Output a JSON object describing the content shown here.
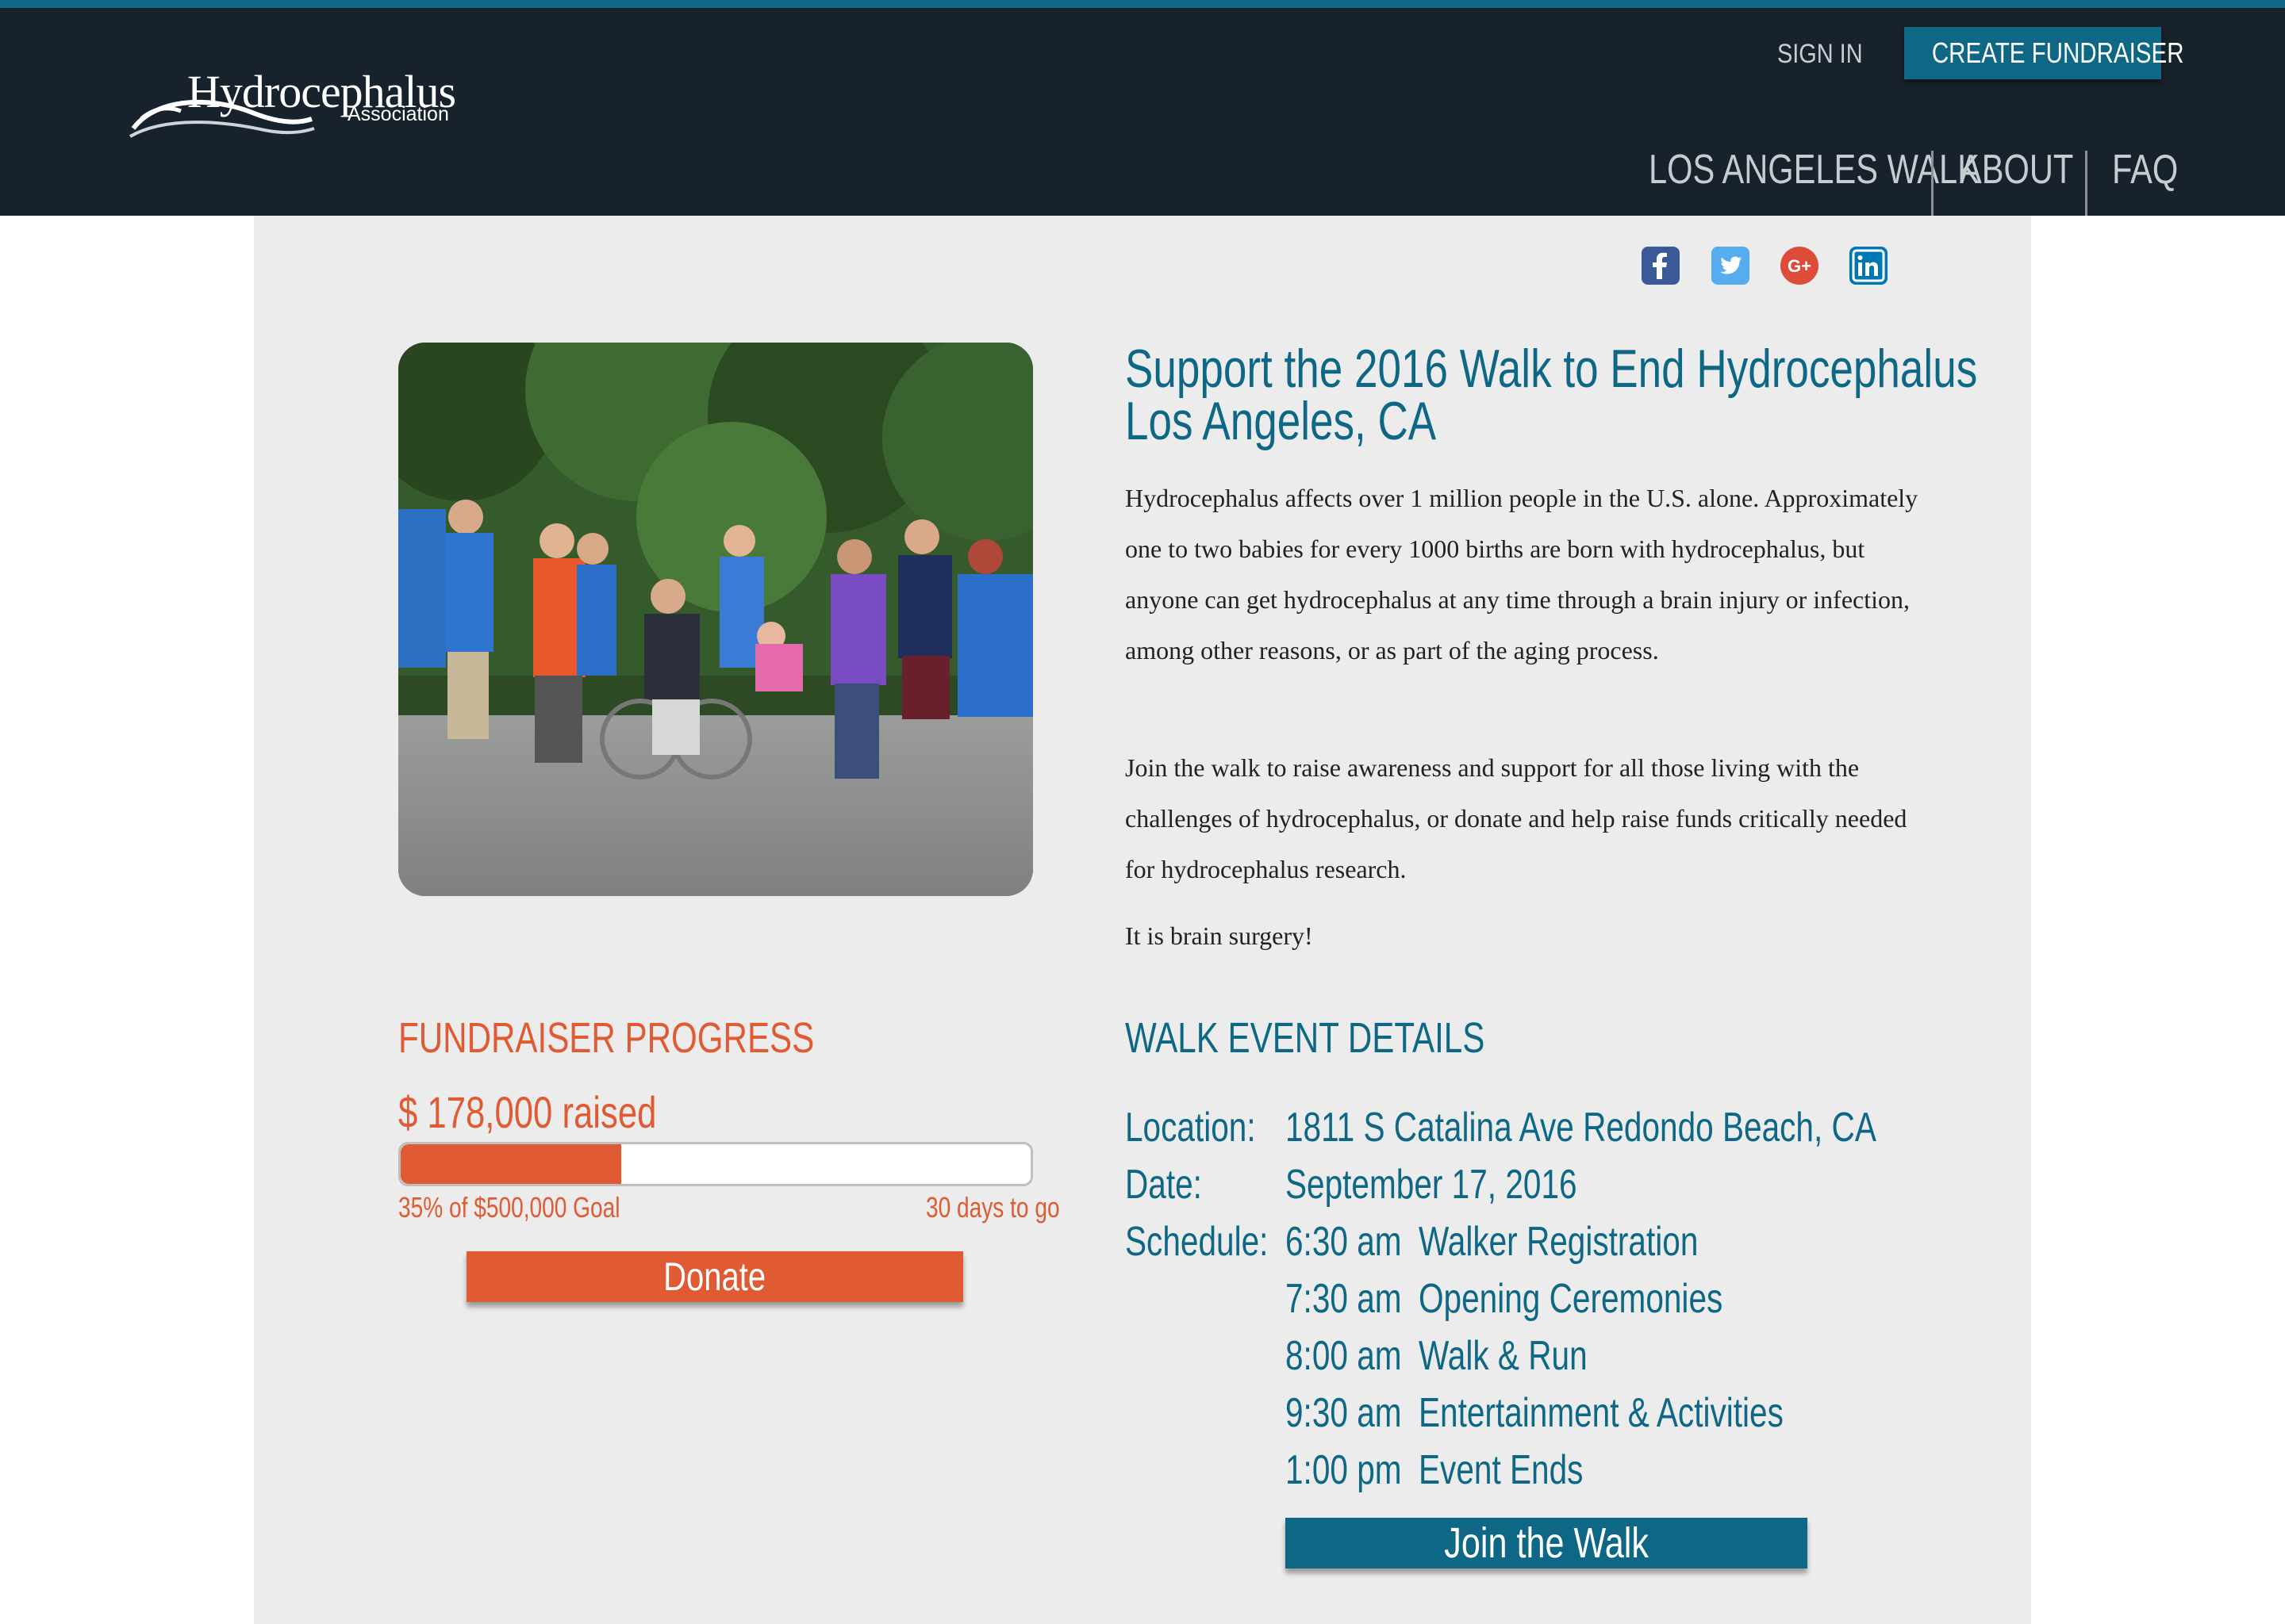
{
  "header": {
    "logo_wordmark": "Hydrocephalus",
    "logo_sub": "Association",
    "sign_in": "SIGN IN",
    "create_fundraiser": "CREATE FUNDRAISER",
    "nav": [
      "LOS ANGELES WALK",
      "ABOUT",
      "FAQ"
    ]
  },
  "social": [
    "facebook-icon",
    "twitter-icon",
    "google-plus-icon",
    "linkedin-icon"
  ],
  "colors": {
    "header_bg": "#18222c",
    "accent_blue": "#0e6785",
    "accent_orange": "#e05a33",
    "panel_bg": "#ececec"
  },
  "main": {
    "title_line1": "Support the 2016 Walk to End Hydrocephalus",
    "title_line2": "Los Angeles, CA",
    "para1": "Hydrocephalus affects over 1 million people in the U.S. alone. Approximately one to two babies for every 1000 births are born with hydrocephalus, but anyone can get hydrocephalus at any time through a brain injury or infection, among other reasons, or as part of the aging process.",
    "para2": "Join the walk to raise awareness and support for all those living with the challenges of hydrocephalus, or donate and help raise funds critically needed for hydrocephalus research.",
    "para3": "It is brain surgery!"
  },
  "fundraiser": {
    "heading": "FUNDRAISER PROGRESS",
    "raised": "$ 178,000 raised",
    "progress_fraction": 0.35,
    "goal_text": "35% of $500,000 Goal",
    "days_text": "30 days to go",
    "donate_label": "Donate"
  },
  "event": {
    "heading": "WALK EVENT DETAILS",
    "location_label": "Location:",
    "location": "1811 S Catalina Ave Redondo Beach, CA",
    "date_label": "Date:",
    "date": "September 17, 2016",
    "schedule_label": "Schedule:",
    "schedule": [
      {
        "time": "6:30 am",
        "item": "Walker Registration"
      },
      {
        "time": "7:30 am",
        "item": "Opening Ceremonies"
      },
      {
        "time": "8:00 am",
        "item": "Walk & Run"
      },
      {
        "time": "9:30 am",
        "item": "Entertainment & Activities"
      },
      {
        "time": "1:00 pm",
        "item": "Event Ends"
      }
    ],
    "join_label": "Join the Walk"
  }
}
